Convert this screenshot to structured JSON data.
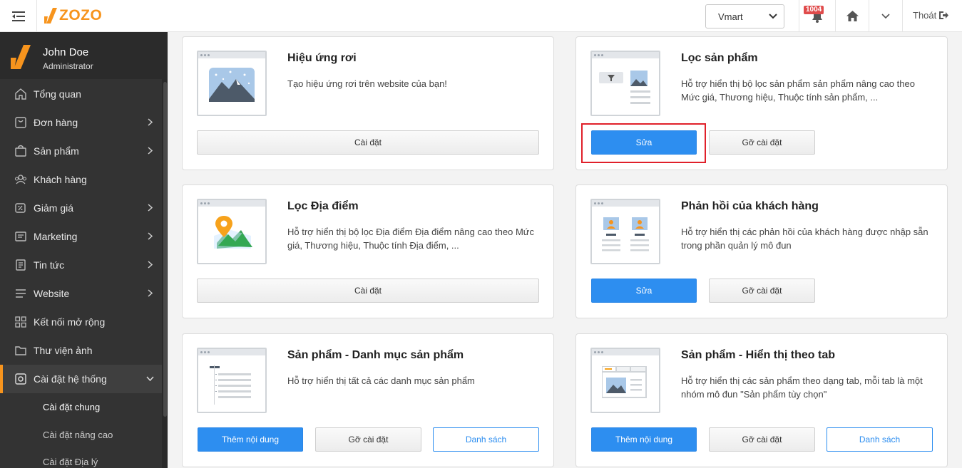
{
  "header": {
    "brand": "ZOZO",
    "store_selected": "Vmart",
    "notification_count": "1004",
    "logout_label": "Thoát"
  },
  "user": {
    "name": "John Doe",
    "role": "Administrator"
  },
  "sidebar": {
    "items": [
      {
        "label": "Tổng quan",
        "icon": "home-icon"
      },
      {
        "label": "Đơn hàng",
        "icon": "cart-icon"
      },
      {
        "label": "Sản phẩm",
        "icon": "bag-icon"
      },
      {
        "label": "Khách hàng",
        "icon": "users-icon"
      },
      {
        "label": "Giảm giá",
        "icon": "discount-icon"
      },
      {
        "label": "Marketing",
        "icon": "marketing-icon"
      },
      {
        "label": "Tin tức",
        "icon": "news-icon"
      },
      {
        "label": "Website",
        "icon": "menu-icon"
      },
      {
        "label": "Kết nối mở rộng",
        "icon": "grid-icon"
      },
      {
        "label": "Thư viện ảnh",
        "icon": "folder-icon"
      },
      {
        "label": "Cài đặt hệ thống",
        "icon": "settings-icon"
      }
    ],
    "subitems": [
      {
        "label": "Cài đặt chung"
      },
      {
        "label": "Cài đặt nâng cao"
      },
      {
        "label": "Cài đặt Địa lý"
      }
    ]
  },
  "modules": [
    {
      "title": "Hiệu ứng rơi",
      "desc": "Tạo hiệu ứng rơi trên website của bạn!",
      "buttons": [
        "Cài đặt"
      ]
    },
    {
      "title": "Lọc sản phẩm",
      "desc": "Hỗ trợ hiển thị bộ lọc sản phẩm sản phẩm nâng cao theo Mức giá, Thương hiệu, Thuộc tính sản phẩm, ...",
      "buttons": [
        "Sửa",
        "Gỡ cài đặt"
      ]
    },
    {
      "title": "Lọc Địa điểm",
      "desc": "Hỗ trợ hiển thị bộ lọc Địa điểm Địa điểm nâng cao theo Mức giá, Thương hiệu, Thuộc tính Địa điểm, ...",
      "buttons": [
        "Cài đặt"
      ]
    },
    {
      "title": "Phản hồi của khách hàng",
      "desc": "Hỗ trợ hiển thị các phản hồi của khách hàng được nhập sẵn trong phần quản lý mô đun",
      "buttons": [
        "Sửa",
        "Gỡ cài đặt"
      ]
    },
    {
      "title": "Sản phẩm - Danh mục sản phẩm",
      "desc": "Hỗ trợ hiển thị tất cả các danh mục sản phẩm",
      "buttons": [
        "Thêm nội dung",
        "Gỡ cài đặt",
        "Danh sách"
      ]
    },
    {
      "title": "Sản phẩm - Hiển thị theo tab",
      "desc": "Hỗ trợ hiển thị các sản phẩm theo dạng tab, mỗi tab là một nhóm mô đun \"Sản phẩm tùy chọn\"",
      "buttons": [
        "Thêm nội dung",
        "Gỡ cài đặt",
        "Danh sách"
      ]
    }
  ],
  "colors": {
    "accent": "#f7941d",
    "primary": "#2d8ef0",
    "highlight": "#e0202a"
  }
}
